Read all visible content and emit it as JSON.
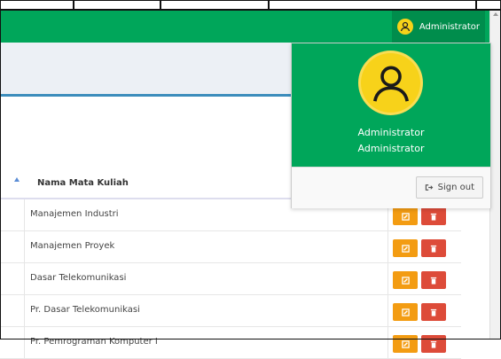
{
  "navbar": {
    "user_name": "Administrator",
    "bg_color": "#00a65a",
    "user_icon": "user-icon"
  },
  "dropdown": {
    "name_line1": "Administrator",
    "name_line2": "Administrator",
    "avatar_icon": "user-icon",
    "signout_label": "Sign out",
    "signout_icon": "sign-out-icon"
  },
  "table": {
    "header": "Nama Mata Kuliah",
    "rows": [
      {
        "name": "Manajemen Industri"
      },
      {
        "name": "Manajemen Proyek"
      },
      {
        "name": "Dasar Telekomunikasi"
      },
      {
        "name": "Pr. Dasar Telekomunikasi"
      },
      {
        "name": "Pr. Pemrograman Komputer I"
      }
    ],
    "edit_icon": "pencil-icon",
    "delete_icon": "trash-icon",
    "edit_color": "#f39c12",
    "delete_color": "#dd4b39"
  }
}
